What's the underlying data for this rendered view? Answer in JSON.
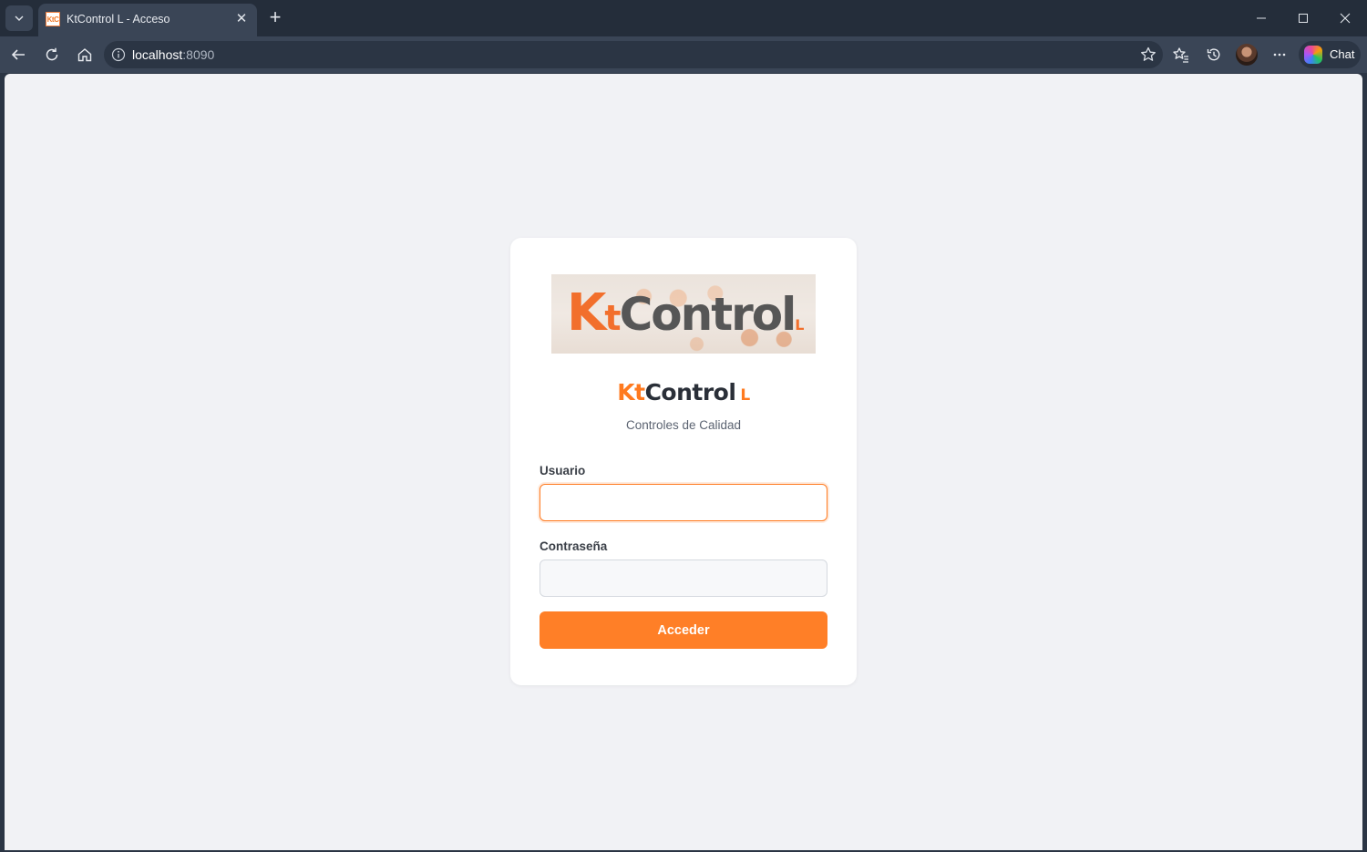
{
  "browser": {
    "tab": {
      "favicon_text": "KtC",
      "title": "KtControl L - Acceso"
    },
    "address": {
      "host": "localhost",
      "port": ":8090"
    },
    "chat_label": "Chat"
  },
  "login": {
    "banner": {
      "k": "K",
      "t": "t",
      "control": "Control",
      "l": "L"
    },
    "brand": {
      "kt": "Kt",
      "control": "Control",
      "suffix": "L"
    },
    "subtitle": "Controles de Calidad",
    "username_label": "Usuario",
    "username_value": "",
    "password_label": "Contraseña",
    "password_value": "",
    "submit_label": "Acceder"
  },
  "colors": {
    "accent": "#ff7f27",
    "logo_orange": "#f26f2c",
    "logo_gray": "#565656",
    "page_bg": "#f1f2f5",
    "browser_chrome": "#3a4556"
  }
}
